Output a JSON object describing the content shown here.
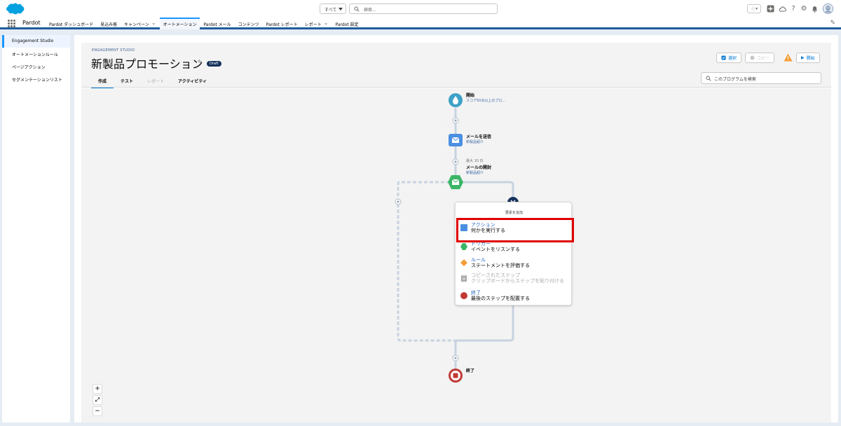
{
  "global_header": {
    "search_scope": "すべて",
    "search_placeholder": "検索..."
  },
  "nav": {
    "app_name": "Pardot",
    "items": [
      {
        "label": "Pardot ダッシュボード",
        "dropdown": false,
        "active": false
      },
      {
        "label": "見込み客",
        "dropdown": false,
        "active": false
      },
      {
        "label": "キャンペーン",
        "dropdown": true,
        "active": false
      },
      {
        "label": "オートメーション",
        "dropdown": false,
        "active": true
      },
      {
        "label": "Pardot メール",
        "dropdown": false,
        "active": false
      },
      {
        "label": "コンテンツ",
        "dropdown": false,
        "active": false
      },
      {
        "label": "Pardot レポート",
        "dropdown": false,
        "active": false
      },
      {
        "label": "レポート",
        "dropdown": true,
        "active": false
      },
      {
        "label": "Pardot 設定",
        "dropdown": false,
        "active": false
      }
    ]
  },
  "sidebar": {
    "items": [
      {
        "label": "Engagement Studio",
        "active": true
      },
      {
        "label": "オートメーションルール",
        "active": false
      },
      {
        "label": "ページアクション",
        "active": false
      },
      {
        "label": "セグメンテーションリスト",
        "active": false
      }
    ]
  },
  "program": {
    "eyebrow": "ENGAGEMENT STUDIO",
    "title": "新製品プロモーション",
    "badge": "Draft",
    "tabs": [
      "作成",
      "テスト",
      "レポート",
      "アクティビティ"
    ],
    "buttons": {
      "select": "選択",
      "copy": "コピー",
      "start": "開始"
    },
    "search_placeholder": "このプログラムを検索"
  },
  "flow": {
    "start": {
      "label": "開始",
      "sub": "スコア50点以上のプロ..."
    },
    "send_email": {
      "label": "メールを送信",
      "sub": "新製品紹介"
    },
    "email_open": {
      "pre": "最大 10 日",
      "label": "メールの開封",
      "sub": "新製品紹介"
    },
    "end": {
      "label": "終了"
    }
  },
  "add_element_menu": {
    "title": "要素を追加",
    "items": [
      {
        "label": "アクション",
        "desc": "何かを実行する",
        "color": "#4a8fe2"
      },
      {
        "label": "トリガー",
        "desc": "イベントをリスンする",
        "color": "#3bb567"
      },
      {
        "label": "ルール",
        "desc": "ステートメントを評価する",
        "color": "#f49d36"
      },
      {
        "label": "コピーされたステップ",
        "desc": "クリップボードからステップを貼り付ける",
        "color": "#a8a8a8"
      },
      {
        "label": "終了",
        "desc": "最後のステップを配置する",
        "color": "#c23934"
      }
    ]
  },
  "zoom_controls": {
    "in": "+",
    "fit": "⤢",
    "out": "−"
  },
  "colors": {
    "brand_blue": "#0176d3",
    "nav_border": "#1f5d9e",
    "start_node": "#3ea1c7",
    "email_node": "#4a8fe2",
    "trigger_node": "#3bb567",
    "end_node": "#c23934",
    "highlight": "#e00000"
  }
}
